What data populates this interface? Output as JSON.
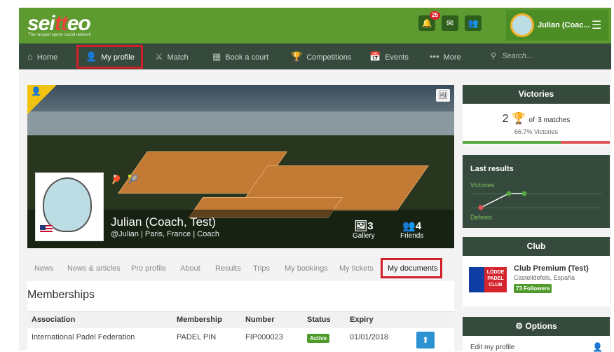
{
  "header": {
    "logo_text": "seiteo",
    "tagline": "The racquet sports social network",
    "notification_count": "25",
    "user_name": "Julian (Coac...",
    "colors": {
      "brand_green": "#5d9a2f",
      "nav_dark": "#354a3c",
      "highlight_red": "#d01f28"
    }
  },
  "nav": {
    "items": [
      {
        "label": "Home",
        "icon": "home-icon"
      },
      {
        "label": "My profile",
        "icon": "user-icon"
      },
      {
        "label": "Match",
        "icon": "rackets-icon"
      },
      {
        "label": "Book a court",
        "icon": "court-icon"
      },
      {
        "label": "Competitions",
        "icon": "trophy-icon"
      },
      {
        "label": "Events",
        "icon": "calendar-icon"
      },
      {
        "label": "More",
        "icon": "dots-icon"
      }
    ],
    "search_placeholder": "Search..."
  },
  "profile": {
    "name": "Julian (Coach, Test)",
    "subtitle": "@Julian | Paris, France | Coach",
    "gallery_count": "3",
    "gallery_label": "Gallery",
    "friends_count": "4",
    "friends_label": "Friends"
  },
  "tabs": [
    "News",
    "News & articles",
    "Pro profile",
    "About",
    "Results",
    "Trips",
    "My bookings",
    "My tickets",
    "My documents"
  ],
  "memberships": {
    "title": "Memberships",
    "columns": [
      "Association",
      "Membership",
      "Number",
      "Status",
      "Expiry"
    ],
    "rows": [
      {
        "association": "International Padel Federation",
        "membership": "PADEL PIN",
        "number": "FIP000023",
        "status": "Active",
        "expiry": "01/01/2018"
      }
    ]
  },
  "victories": {
    "title": "Victories",
    "wins": "2",
    "of_text": "of",
    "total_text": "3 matches",
    "pct_text": "66.7% Victories",
    "win_fraction": 0.667
  },
  "last_results": {
    "title": "Last results",
    "victories_label": "Victories",
    "defeats_label": "Defeats",
    "sequence": [
      "defeat",
      "victory",
      "victory"
    ]
  },
  "club": {
    "title": "Club",
    "name": "Club Premium (Test)",
    "location": "Castelldefels, España",
    "followers": "73 Followers",
    "logo_text": "LÖDDE PADEL CLUB"
  },
  "options": {
    "title": "Options",
    "items": [
      "Edit my profile"
    ]
  }
}
